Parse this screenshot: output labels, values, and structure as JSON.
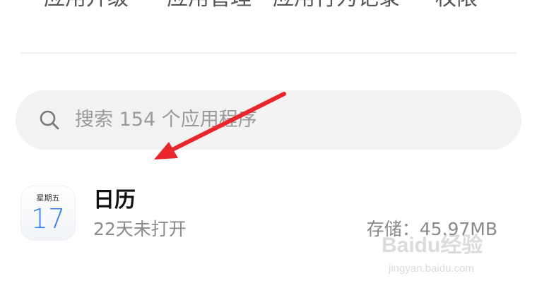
{
  "top_tabs": [
    "应用升级",
    "应用管理",
    "应用行为记录",
    "权限"
  ],
  "search": {
    "placeholder": "搜索 154 个应用程序",
    "icon": "search-icon"
  },
  "app": {
    "icon": "calendar-icon",
    "icon_weekday": "星期五",
    "icon_day": "17",
    "name": "日历",
    "last_opened": "22天未打开",
    "storage": "存储：45.97MB"
  },
  "annotation": {
    "color": "#e8262b"
  },
  "watermark": {
    "brand": "Baidu经验",
    "url": "jingyan.baidu.com"
  },
  "colors": {
    "search_bg": "#f2f2f2",
    "calendar_blue": "#2e7df0",
    "secondary_text": "#8a8a8a"
  }
}
